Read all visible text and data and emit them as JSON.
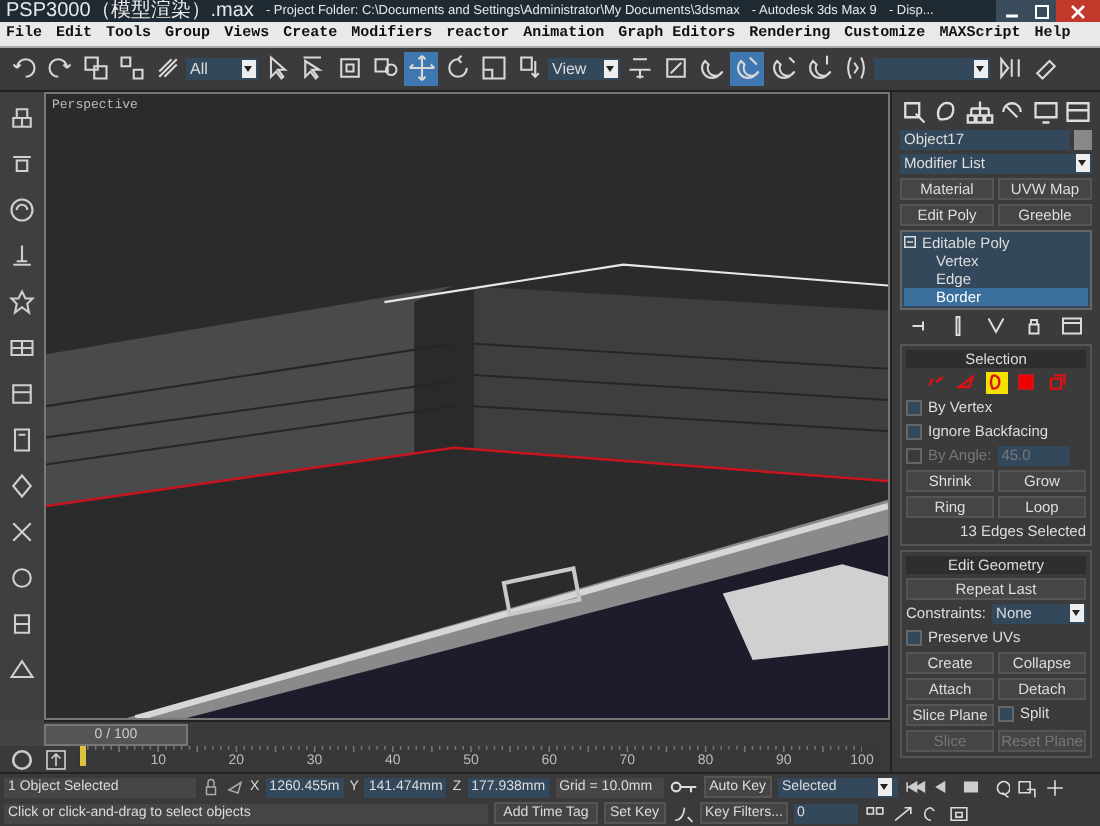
{
  "window": {
    "file_name": "PSP3000（模型渲染）.max",
    "project_folder": "- Project Folder: C:\\Documents and Settings\\Administrator\\My Documents\\3dsmax",
    "app": "- Autodesk 3ds Max 9",
    "document": "- Disp..."
  },
  "menu": [
    "File",
    "Edit",
    "Tools",
    "Group",
    "Views",
    "Create",
    "Modifiers",
    "reactor",
    "Animation",
    "Graph Editors",
    "Rendering",
    "Customize",
    "MAXScript",
    "Help"
  ],
  "toolbar": {
    "selection_filter": "All",
    "reference_coord": "View",
    "tools": [
      {
        "selected": false
      },
      {
        "selected": false
      },
      {
        "selected": false
      },
      {
        "selected": false
      },
      {
        "selected": false
      },
      {
        "selected": false
      },
      {
        "selected": false
      },
      {
        "selected": false
      },
      {
        "selected": false
      },
      {
        "selected": true
      },
      {
        "selected": false
      },
      {
        "selected": false
      },
      {
        "selected": false
      },
      {
        "selected": false
      },
      {
        "selected": false
      },
      {
        "selected": false
      },
      {
        "selected": true
      },
      {
        "selected": false
      },
      {
        "selected": false
      },
      {
        "selected": false
      },
      {
        "selected": false
      },
      {
        "selected": false
      }
    ]
  },
  "viewport": {
    "label": "Perspective"
  },
  "command_panel": {
    "object_name": "Object17",
    "modifier_list": "Modifier List",
    "modifier_buttons": [
      "Material",
      "UVW Map",
      "Edit Poly",
      "Greeble"
    ],
    "stack": [
      {
        "label": "Editable Poly",
        "expanded": true,
        "children": [
          {
            "label": "Vertex",
            "selected": false
          },
          {
            "label": "Edge",
            "selected": false
          },
          {
            "label": "Border",
            "selected": true
          }
        ]
      }
    ],
    "selection": {
      "title": "Selection",
      "subobjects": [
        {
          "selected": false
        },
        {
          "selected": false
        },
        {
          "selected": true
        },
        {
          "selected": false
        },
        {
          "selected": false
        }
      ],
      "options": [
        {
          "label": "By Vertex",
          "checked": false,
          "disabled": false
        },
        {
          "label": "Ignore Backfacing",
          "checked": false,
          "disabled": false
        },
        {
          "label": "By Angle:",
          "checked": false,
          "disabled": true,
          "value": "45.0"
        }
      ],
      "buttons": [
        [
          "Shrink",
          "Grow"
        ],
        [
          "Ring",
          "Loop"
        ]
      ],
      "info": "13 Edges Selected"
    },
    "edit_geometry": {
      "title": "Edit Geometry",
      "repeat": "Repeat Last",
      "constraints_label": "Constraints:",
      "constraints": "None",
      "preserve_uvs": {
        "label": "Preserve UVs",
        "checked": false
      },
      "buttons": [
        {
          "label": "Create",
          "disabled": false
        },
        {
          "label": "Collapse",
          "disabled": false
        },
        {
          "label": "Attach",
          "disabled": false
        },
        {
          "label": "Detach",
          "disabled": false
        }
      ],
      "slice_plane": "Slice Plane",
      "split": {
        "label": "Split",
        "checked": false
      },
      "slice_buttons": [
        {
          "label": "Slice",
          "disabled": true
        },
        {
          "label": "Reset Plane",
          "disabled": true
        }
      ]
    }
  },
  "timeline": {
    "label": "0 / 100",
    "level": 0,
    "ticks": [
      "10",
      "20",
      "30",
      "40",
      "50",
      "60",
      "70",
      "80",
      "90",
      "100"
    ]
  },
  "status_bar": {
    "selection": "1 Object Selected",
    "x_label": "X",
    "y_label": "Y",
    "z_label": "Z",
    "x": "1260.455m",
    "y": "141.474mm",
    "z": "177.938mm",
    "grid": "Grid = 10.0mm",
    "auto_key": "Auto Key",
    "key_mode": "Selected",
    "set_key": "Set Key",
    "key_filters": "Key Filters...",
    "frame": "0",
    "prompt": "Click or click-and-drag to select objects",
    "time_tag": "Add Time Tag"
  }
}
